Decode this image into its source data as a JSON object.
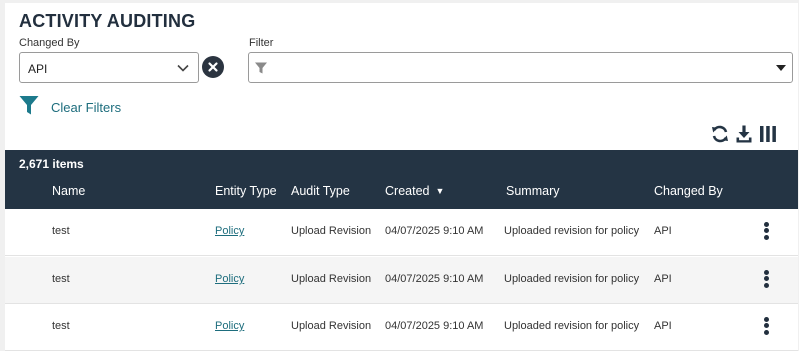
{
  "page": {
    "title": "ACTIVITY AUDITING"
  },
  "filters": {
    "changed_by_label": "Changed By",
    "changed_by_value": "API",
    "filter_label": "Filter",
    "filter_value": "",
    "clear_filters_label": "Clear Filters"
  },
  "toolbar": {
    "icons": [
      "refresh-icon",
      "download-icon",
      "columns-icon"
    ]
  },
  "grid": {
    "item_count": "2,671 items",
    "columns": [
      "Name",
      "Entity Type",
      "Audit Type",
      "Created",
      "Summary",
      "Changed By"
    ],
    "sort_column": "Created",
    "sort_direction": "descending",
    "rows": [
      {
        "name": "test",
        "entity_type": "Policy",
        "audit_type": "Upload Revision",
        "created": "04/07/2025 9:10 AM",
        "summary": "Uploaded revision for policy",
        "changed_by": "API"
      },
      {
        "name": "test",
        "entity_type": "Policy",
        "audit_type": "Upload Revision",
        "created": "04/07/2025 9:10 AM",
        "summary": "Uploaded revision for policy",
        "changed_by": "API"
      },
      {
        "name": "test",
        "entity_type": "Policy",
        "audit_type": "Upload Revision",
        "created": "04/07/2025 9:10 AM",
        "summary": "Uploaded revision for policy",
        "changed_by": "API"
      }
    ]
  },
  "colors": {
    "header_bg": "#243444",
    "link": "#1d6d7d",
    "accent_icon": "#1d7a8c"
  }
}
